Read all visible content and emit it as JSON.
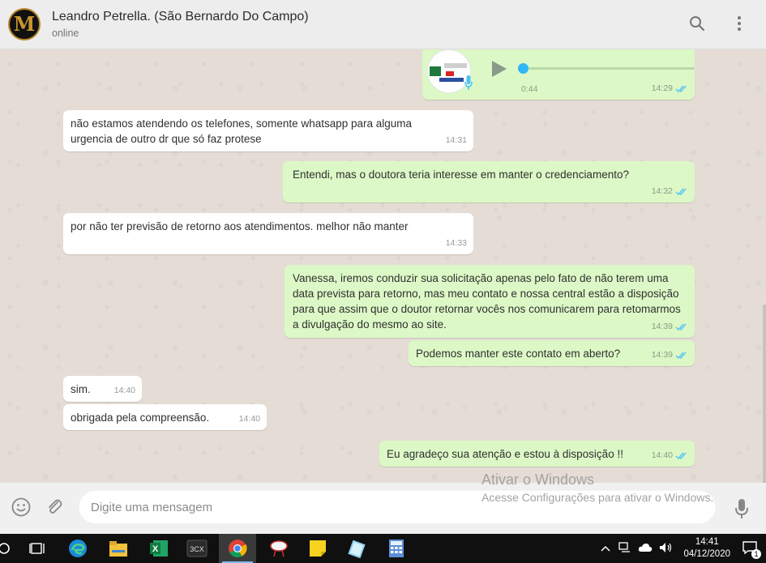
{
  "header": {
    "contact_name": "Leandro Petrella. (São Bernardo Do Campo)",
    "status": "online",
    "avatar_letter": "M"
  },
  "messages": [
    {
      "dir": "out",
      "type": "audio",
      "duration": "0:44",
      "time": "14:29",
      "ticks": "read"
    },
    {
      "dir": "in",
      "text": "não estamos atendendo os telefones, somente whatsapp para alguma urgencia de outro dr que só faz protese",
      "time": "14:31"
    },
    {
      "dir": "out",
      "text": "Entendi, mas o doutora teria interesse em manter o credenciamento?",
      "time": "14:32",
      "ticks": "read"
    },
    {
      "dir": "in",
      "text": "por não ter previsão de retorno aos atendimentos. melhor não manter",
      "time": "14:33"
    },
    {
      "dir": "out",
      "text": "Vanessa, iremos conduzir sua solicitação apenas pelo fato de não terem uma data prevista para retorno, mas meu contato e nossa central estão a disposição para que assim que o doutor retornar vocês nos comunicarem para retomarmos a divulgação do mesmo ao site.",
      "time": "14:39",
      "ticks": "read"
    },
    {
      "dir": "out",
      "text": "Podemos manter este contato em aberto?",
      "time": "14:39",
      "ticks": "read"
    },
    {
      "dir": "in",
      "text": "sim.",
      "time": "14:40"
    },
    {
      "dir": "in",
      "text": "obrigada pela compreensão.",
      "time": "14:40"
    },
    {
      "dir": "out",
      "text": "Eu agradeço sua atenção e estou à disposição !!",
      "time": "14:40",
      "ticks": "read"
    }
  ],
  "composer": {
    "placeholder": "Digite uma mensagem"
  },
  "watermark": {
    "title": "Ativar o Windows",
    "subtitle": "Acesse Configurações para ativar o Windows."
  },
  "taskbar": {
    "apps": [
      "task-view",
      "edge",
      "file-explorer",
      "excel",
      "3cx",
      "chrome",
      "snipping-tool",
      "sticky-notes",
      "notepad",
      "calculator"
    ],
    "label_3cx": "3CX",
    "label_excel": "X",
    "time": "14:41",
    "date": "04/12/2020",
    "notifications": "1"
  },
  "colors": {
    "chat_bg": "#e5ddd5",
    "bubble_out": "#dcf8c6",
    "bubble_in": "#ffffff",
    "read_ticks": "#4fc3f7"
  }
}
